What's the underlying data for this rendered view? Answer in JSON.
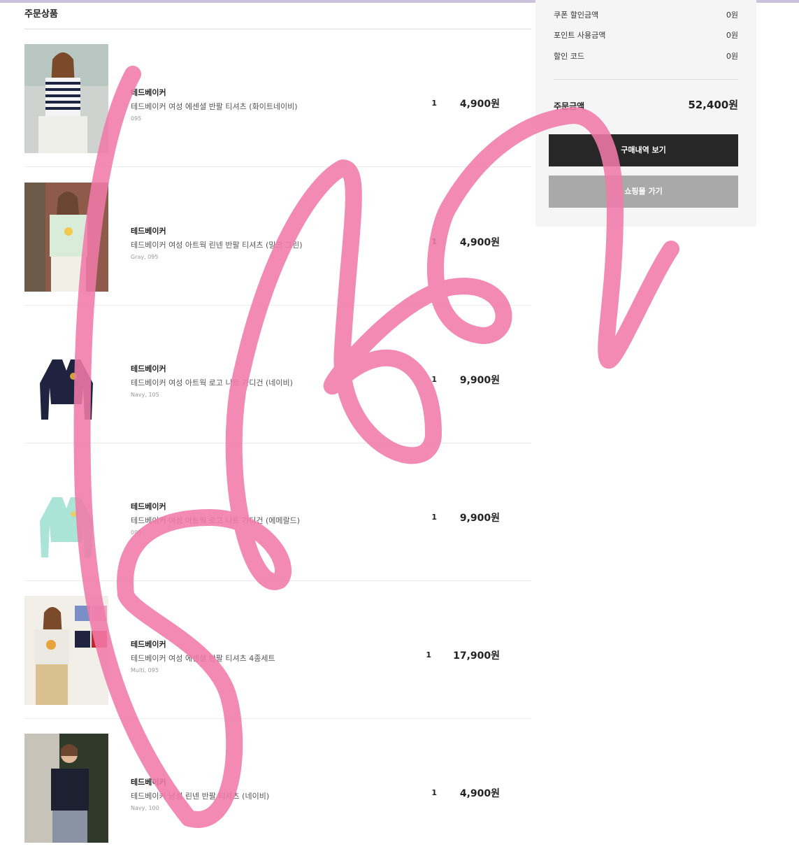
{
  "section_title": "주문상품",
  "items": [
    {
      "brand": "테드베이커",
      "name": "테드베이커 여성 에센셜 반팔 티셔츠 (화이트네이비)",
      "option": "095",
      "qty": "1",
      "price": "4,900원"
    },
    {
      "brand": "테드베이커",
      "name": "테드베이커 여성 아트웍 린넨 반팔 티셔츠 (밀크 그린)",
      "option": "Gray, 095",
      "qty": "1",
      "price": "4,900원"
    },
    {
      "brand": "테드베이커",
      "name": "테드베이커 여성 아트웍 로고 니트 가디건 (네이비)",
      "option": "Navy, 105",
      "qty": "1",
      "price": "9,900원"
    },
    {
      "brand": "테드베이커",
      "name": "테드베이커 여성 아트웍 로고 니트 가디건 (에메랄드)",
      "option": "095",
      "qty": "1",
      "price": "9,900원"
    },
    {
      "brand": "테드베이커",
      "name": "테드베이커 여성 에센셜 반팔 티셔츠 4종세트",
      "option": "Multi, 095",
      "qty": "1",
      "price": "17,900원"
    },
    {
      "brand": "테드베이커",
      "name": "테드베이커 남성 린넨 반팔 티셔츠 (네이비)",
      "option": "Navy, 100",
      "qty": "1",
      "price": "4,900원"
    }
  ],
  "summary": {
    "coupon_label": "쿠폰 할인금액",
    "coupon_value": "0원",
    "point_label": "포인트 사용금액",
    "point_value": "0원",
    "code_label": "할인 코드",
    "code_value": "0원",
    "total_label": "주문금액",
    "total_value": "52,400원",
    "btn_history": "구매내역 보기",
    "btn_shop": "쇼핑몰 가기"
  },
  "colors": {
    "dark_button": "#272727",
    "gray_button": "#a9a9a9",
    "scribble": "#f07aa8",
    "panel": "#f5f5f5"
  },
  "icons": [
    "striped-tshirt-photo",
    "mint-tshirt-photo",
    "navy-cardigan-photo",
    "mint-cardigan-photo",
    "tshirt-set-photo",
    "navy-tshirt-photo"
  ]
}
